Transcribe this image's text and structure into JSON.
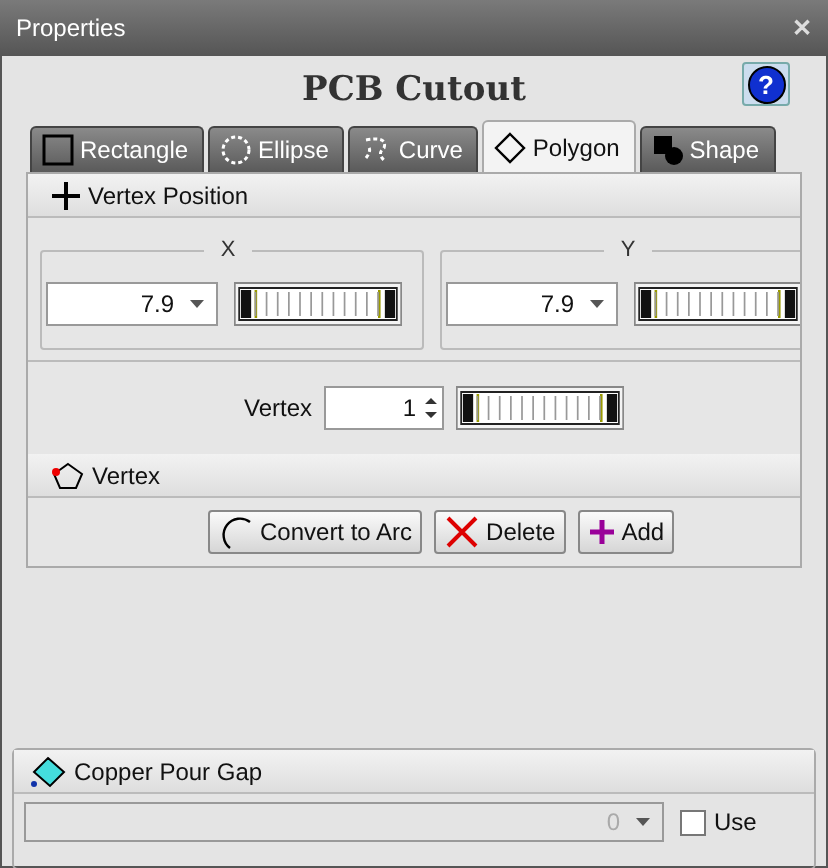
{
  "window": {
    "title": "Properties",
    "close": "✕"
  },
  "heading": "PCB Cutout",
  "help_button": "?",
  "tabs": [
    {
      "label": "Rectangle",
      "selected": false
    },
    {
      "label": "Ellipse",
      "selected": false
    },
    {
      "label": "Curve",
      "selected": false
    },
    {
      "label": "Polygon",
      "selected": true
    },
    {
      "label": "Shape",
      "selected": false
    }
  ],
  "vertex_position": {
    "title": "Vertex Position",
    "groups": [
      {
        "label": "X",
        "value": "7.9"
      },
      {
        "label": "Y",
        "value": "7.9"
      }
    ],
    "vertex_label": "Vertex",
    "vertex_value": "1"
  },
  "vertex": {
    "title": "Vertex",
    "buttons": [
      {
        "label": "Convert to Arc"
      },
      {
        "label": "Delete"
      },
      {
        "label": "Add"
      }
    ]
  },
  "copper_pour_gap": {
    "title": "Copper Pour Gap",
    "value": "0",
    "disabled": true,
    "use": {
      "label": "Use",
      "checked": false
    }
  }
}
